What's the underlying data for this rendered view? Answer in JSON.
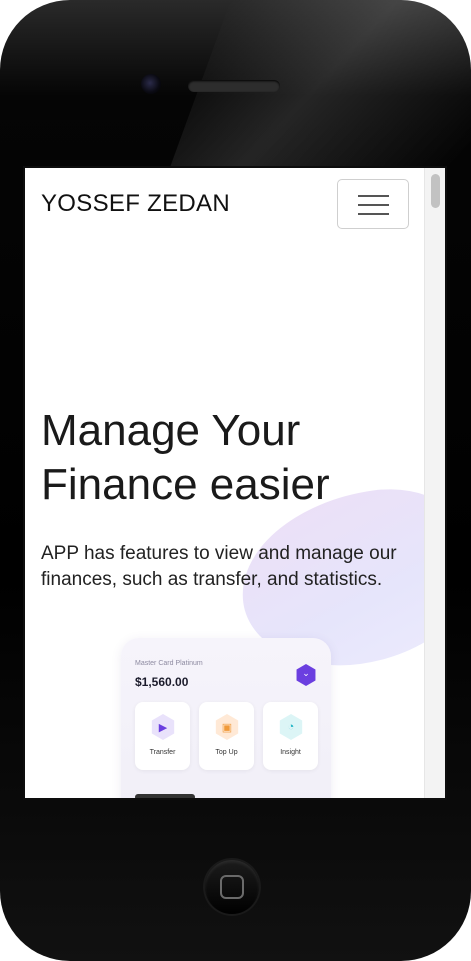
{
  "navbar": {
    "brand": "YOSSEF ZEDAN",
    "menu_icon": "hamburger-menu-icon"
  },
  "hero": {
    "title_line1": "Manage Your",
    "title_line2": "Finance easier",
    "description": "APP has features to view and manage our finances, such as transfer, and statistics."
  },
  "card": {
    "label": "Master Card Platinum",
    "amount": "$1,560.00",
    "actions": [
      {
        "label": "Transfer",
        "icon": "send-icon",
        "color": "#e9e2fb",
        "glyph_color": "#6b3fe0"
      },
      {
        "label": "Top Up",
        "icon": "card-icon",
        "color": "#ffe9d6",
        "glyph_color": "#f09a3a"
      },
      {
        "label": "Insight",
        "icon": "pie-chart-icon",
        "color": "#dcf5f6",
        "glyph_color": "#23b6c6"
      }
    ]
  },
  "colors": {
    "accent": "#6b3fe0",
    "blob": "#e6e5fb"
  }
}
